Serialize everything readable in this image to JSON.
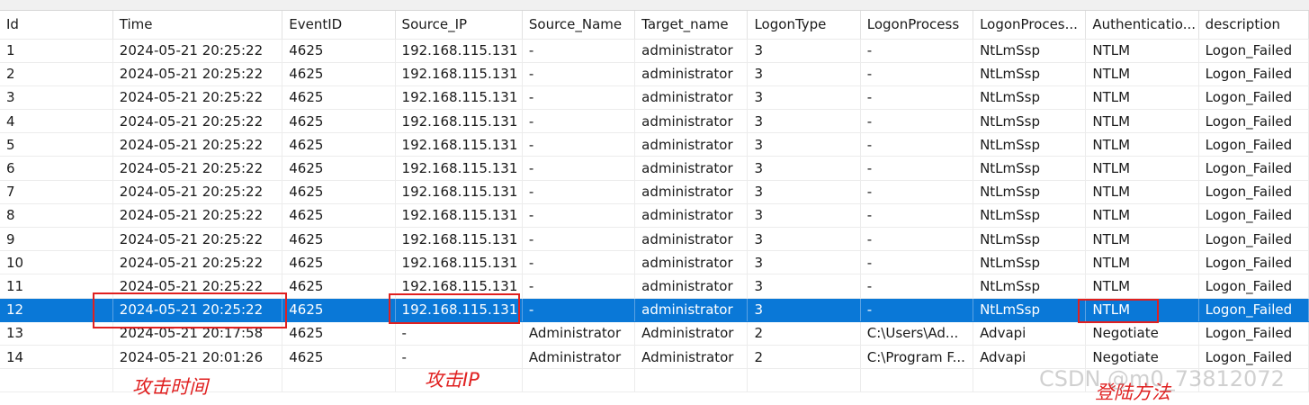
{
  "columns": [
    "Id",
    "Time",
    "EventID",
    "Source_IP",
    "Source_Name",
    "Target_name",
    "LogonType",
    "LogonProcess",
    "LogonProces...",
    "Authenticatio...",
    "description"
  ],
  "rows": [
    [
      "1",
      "2024-05-21 20:25:22",
      "4625",
      "192.168.115.131",
      "-",
      "administrator",
      "3",
      "-",
      "NtLmSsp",
      "NTLM",
      "Logon_Failed"
    ],
    [
      "2",
      "2024-05-21 20:25:22",
      "4625",
      "192.168.115.131",
      "-",
      "administrator",
      "3",
      "-",
      "NtLmSsp",
      "NTLM",
      "Logon_Failed"
    ],
    [
      "3",
      "2024-05-21 20:25:22",
      "4625",
      "192.168.115.131",
      "-",
      "administrator",
      "3",
      "-",
      "NtLmSsp",
      "NTLM",
      "Logon_Failed"
    ],
    [
      "4",
      "2024-05-21 20:25:22",
      "4625",
      "192.168.115.131",
      "-",
      "administrator",
      "3",
      "-",
      "NtLmSsp",
      "NTLM",
      "Logon_Failed"
    ],
    [
      "5",
      "2024-05-21 20:25:22",
      "4625",
      "192.168.115.131",
      "-",
      "administrator",
      "3",
      "-",
      "NtLmSsp",
      "NTLM",
      "Logon_Failed"
    ],
    [
      "6",
      "2024-05-21 20:25:22",
      "4625",
      "192.168.115.131",
      "-",
      "administrator",
      "3",
      "-",
      "NtLmSsp",
      "NTLM",
      "Logon_Failed"
    ],
    [
      "7",
      "2024-05-21 20:25:22",
      "4625",
      "192.168.115.131",
      "-",
      "administrator",
      "3",
      "-",
      "NtLmSsp",
      "NTLM",
      "Logon_Failed"
    ],
    [
      "8",
      "2024-05-21 20:25:22",
      "4625",
      "192.168.115.131",
      "-",
      "administrator",
      "3",
      "-",
      "NtLmSsp",
      "NTLM",
      "Logon_Failed"
    ],
    [
      "9",
      "2024-05-21 20:25:22",
      "4625",
      "192.168.115.131",
      "-",
      "administrator",
      "3",
      "-",
      "NtLmSsp",
      "NTLM",
      "Logon_Failed"
    ],
    [
      "10",
      "2024-05-21 20:25:22",
      "4625",
      "192.168.115.131",
      "-",
      "administrator",
      "3",
      "-",
      "NtLmSsp",
      "NTLM",
      "Logon_Failed"
    ],
    [
      "11",
      "2024-05-21 20:25:22",
      "4625",
      "192.168.115.131",
      "-",
      "administrator",
      "3",
      "-",
      "NtLmSsp",
      "NTLM",
      "Logon_Failed"
    ],
    [
      "12",
      "2024-05-21 20:25:22",
      "4625",
      "192.168.115.131",
      "-",
      "administrator",
      "3",
      "-",
      "NtLmSsp",
      "NTLM",
      "Logon_Failed"
    ],
    [
      "13",
      "2024-05-21 20:17:58",
      "4625",
      "-",
      "Administrator",
      "Administrator",
      "2",
      "C:\\Users\\Ad...",
      "Advapi",
      "Negotiate",
      "Logon_Failed"
    ],
    [
      "14",
      "2024-05-21 20:01:26",
      "4625",
      "-",
      "Administrator",
      "Administrator",
      "2",
      "C:\\Program F...",
      "Advapi",
      "Negotiate",
      "Logon_Failed"
    ]
  ],
  "selected_row_id": "12",
  "annotations": {
    "attack_time": "攻击时间",
    "attack_ip": "攻击IP",
    "logon_method": "登陆方法"
  },
  "watermark": "CSDN @m0_73812072",
  "colors": {
    "selection": "#0a78d7",
    "annotation_red": "#e02020"
  }
}
